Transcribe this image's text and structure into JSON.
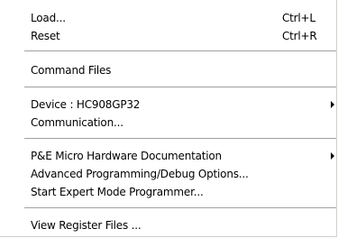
{
  "menu": {
    "items": [
      {
        "label": "Load...",
        "shortcut": "Ctrl+L"
      },
      {
        "label": "Reset",
        "shortcut": "Ctrl+R"
      },
      {
        "label": "Command Files"
      },
      {
        "label": "Device : HC908GP32",
        "submenu": true
      },
      {
        "label": "Communication..."
      },
      {
        "label": "P&E Micro Hardware Documentation",
        "submenu": true
      },
      {
        "label": "Advanced Programming/Debug Options..."
      },
      {
        "label": "Start Expert Mode Programmer..."
      },
      {
        "label": "View Register Files ..."
      }
    ],
    "submenu_arrow_icon": "triangle-right-icon"
  },
  "colors": {
    "background": "#ffffff",
    "separator": "#a0a0a0",
    "text": "#000000"
  }
}
